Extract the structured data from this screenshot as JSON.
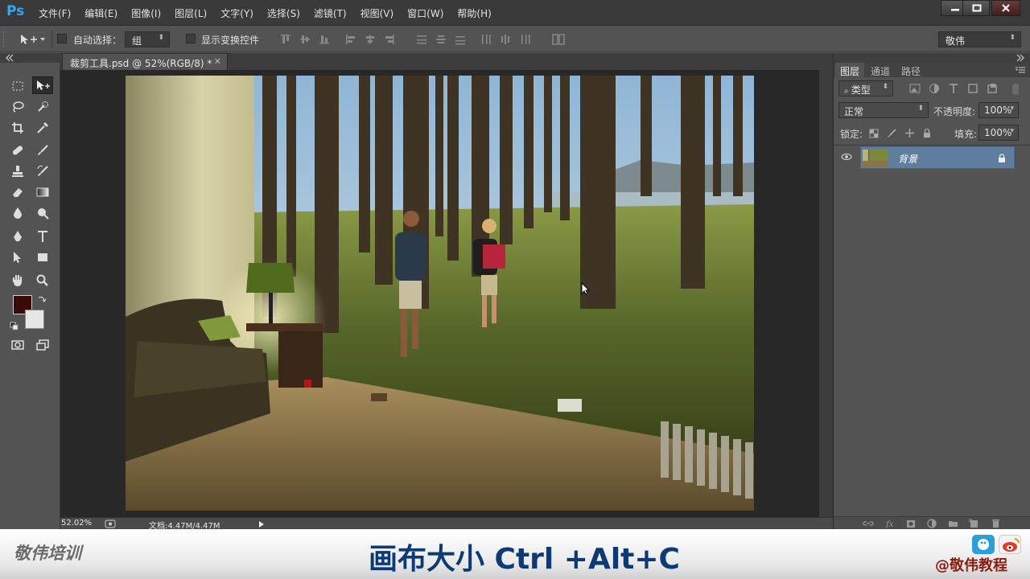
{
  "app": {
    "logo": "Ps"
  },
  "menubar": {
    "items": [
      "文件(F)",
      "编辑(E)",
      "图像(I)",
      "图层(L)",
      "文字(Y)",
      "选择(S)",
      "滤镜(T)",
      "视图(V)",
      "窗口(W)",
      "帮助(H)"
    ]
  },
  "window_controls": {
    "icons": [
      "minimize-icon",
      "restore-icon",
      "close-icon"
    ]
  },
  "options_bar": {
    "auto_select_label": "自动选择：",
    "auto_select_value": "组",
    "show_transform_label": "显示变换控件",
    "workspace_value": "敬伟"
  },
  "document": {
    "tab_title": "裁剪工具.psd @ 52%(RGB/8) *",
    "zoom": "52.02%",
    "doc_size": "文档:4.47M/4.47M"
  },
  "colors": {
    "foreground": "#3a0a07",
    "background": "#e6e6e6",
    "selected_layer": "#5f7d9e",
    "caption_text": "#0b3a74"
  },
  "layers_panel": {
    "tabs": [
      "图层",
      "通道",
      "路径"
    ],
    "filter_value": "类型",
    "blend_mode": "正常",
    "opacity_label": "不透明度:",
    "opacity_value": "100%",
    "lock_label": "锁定:",
    "fill_label": "填充:",
    "fill_value": "100%",
    "layers": [
      {
        "name": "背景",
        "visible": true,
        "locked": true
      }
    ]
  },
  "caption": {
    "logo": "敬伟培训",
    "text": "画布大小 Ctrl +Alt+C",
    "weibo": "@敬伟教程"
  }
}
